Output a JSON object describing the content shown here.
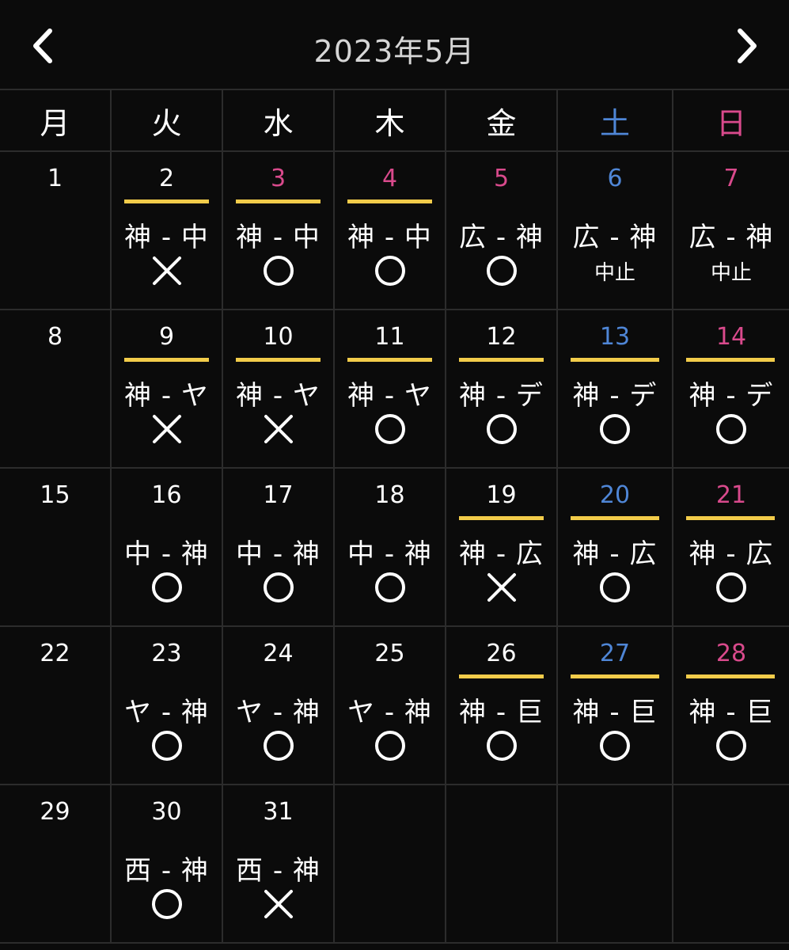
{
  "header": {
    "title": "2023年5月",
    "prev_icon": "chevron-left-icon",
    "next_icon": "chevron-right-icon"
  },
  "colors": {
    "background": "#0b0b0b",
    "grid_line": "#2c2c2c",
    "text": "#ffffff",
    "saturday": "#4f86d6",
    "sunday_holiday": "#d94a8c",
    "game_bar": "#f2cc4a"
  },
  "weekdays": [
    {
      "label": "月",
      "color": "#ffffff"
    },
    {
      "label": "火",
      "color": "#ffffff"
    },
    {
      "label": "水",
      "color": "#ffffff"
    },
    {
      "label": "木",
      "color": "#ffffff"
    },
    {
      "label": "金",
      "color": "#ffffff"
    },
    {
      "label": "土",
      "color": "#4f86d6"
    },
    {
      "label": "日",
      "color": "#d94a8c"
    }
  ],
  "weeks": [
    [
      {
        "day": "1",
        "color": "#ffffff",
        "bar": false,
        "match": "",
        "result": ""
      },
      {
        "day": "2",
        "color": "#ffffff",
        "bar": true,
        "match": "神 - 中",
        "result": "×"
      },
      {
        "day": "3",
        "color": "#d94a8c",
        "bar": true,
        "match": "神 - 中",
        "result": "○"
      },
      {
        "day": "4",
        "color": "#d94a8c",
        "bar": true,
        "match": "神 - 中",
        "result": "○"
      },
      {
        "day": "5",
        "color": "#d94a8c",
        "bar": false,
        "match": "広 - 神",
        "result": "○"
      },
      {
        "day": "6",
        "color": "#4f86d6",
        "bar": false,
        "match": "広 - 神",
        "result": "中止"
      },
      {
        "day": "7",
        "color": "#d94a8c",
        "bar": false,
        "match": "広 - 神",
        "result": "中止"
      }
    ],
    [
      {
        "day": "8",
        "color": "#ffffff",
        "bar": false,
        "match": "",
        "result": ""
      },
      {
        "day": "9",
        "color": "#ffffff",
        "bar": true,
        "match": "神 - ヤ",
        "result": "×"
      },
      {
        "day": "10",
        "color": "#ffffff",
        "bar": true,
        "match": "神 - ヤ",
        "result": "×"
      },
      {
        "day": "11",
        "color": "#ffffff",
        "bar": true,
        "match": "神 - ヤ",
        "result": "○"
      },
      {
        "day": "12",
        "color": "#ffffff",
        "bar": true,
        "match": "神 - デ",
        "result": "○"
      },
      {
        "day": "13",
        "color": "#4f86d6",
        "bar": true,
        "match": "神 - デ",
        "result": "○"
      },
      {
        "day": "14",
        "color": "#d94a8c",
        "bar": true,
        "match": "神 - デ",
        "result": "○"
      }
    ],
    [
      {
        "day": "15",
        "color": "#ffffff",
        "bar": false,
        "match": "",
        "result": ""
      },
      {
        "day": "16",
        "color": "#ffffff",
        "bar": false,
        "match": "中 - 神",
        "result": "○"
      },
      {
        "day": "17",
        "color": "#ffffff",
        "bar": false,
        "match": "中 - 神",
        "result": "○"
      },
      {
        "day": "18",
        "color": "#ffffff",
        "bar": false,
        "match": "中 - 神",
        "result": "○"
      },
      {
        "day": "19",
        "color": "#ffffff",
        "bar": true,
        "match": "神 - 広",
        "result": "×"
      },
      {
        "day": "20",
        "color": "#4f86d6",
        "bar": true,
        "match": "神 - 広",
        "result": "○"
      },
      {
        "day": "21",
        "color": "#d94a8c",
        "bar": true,
        "match": "神 - 広",
        "result": "○"
      }
    ],
    [
      {
        "day": "22",
        "color": "#ffffff",
        "bar": false,
        "match": "",
        "result": ""
      },
      {
        "day": "23",
        "color": "#ffffff",
        "bar": false,
        "match": "ヤ - 神",
        "result": "○"
      },
      {
        "day": "24",
        "color": "#ffffff",
        "bar": false,
        "match": "ヤ - 神",
        "result": "○"
      },
      {
        "day": "25",
        "color": "#ffffff",
        "bar": false,
        "match": "ヤ - 神",
        "result": "○"
      },
      {
        "day": "26",
        "color": "#ffffff",
        "bar": true,
        "match": "神 - 巨",
        "result": "○"
      },
      {
        "day": "27",
        "color": "#4f86d6",
        "bar": true,
        "match": "神 - 巨",
        "result": "○"
      },
      {
        "day": "28",
        "color": "#d94a8c",
        "bar": true,
        "match": "神 - 巨",
        "result": "○"
      }
    ],
    [
      {
        "day": "29",
        "color": "#ffffff",
        "bar": false,
        "match": "",
        "result": ""
      },
      {
        "day": "30",
        "color": "#ffffff",
        "bar": false,
        "match": "西 - 神",
        "result": "○"
      },
      {
        "day": "31",
        "color": "#ffffff",
        "bar": false,
        "match": "西 - 神",
        "result": "×"
      },
      {
        "day": "",
        "color": "#ffffff",
        "bar": false,
        "match": "",
        "result": ""
      },
      {
        "day": "",
        "color": "#ffffff",
        "bar": false,
        "match": "",
        "result": ""
      },
      {
        "day": "",
        "color": "#ffffff",
        "bar": false,
        "match": "",
        "result": ""
      },
      {
        "day": "",
        "color": "#ffffff",
        "bar": false,
        "match": "",
        "result": ""
      }
    ]
  ]
}
